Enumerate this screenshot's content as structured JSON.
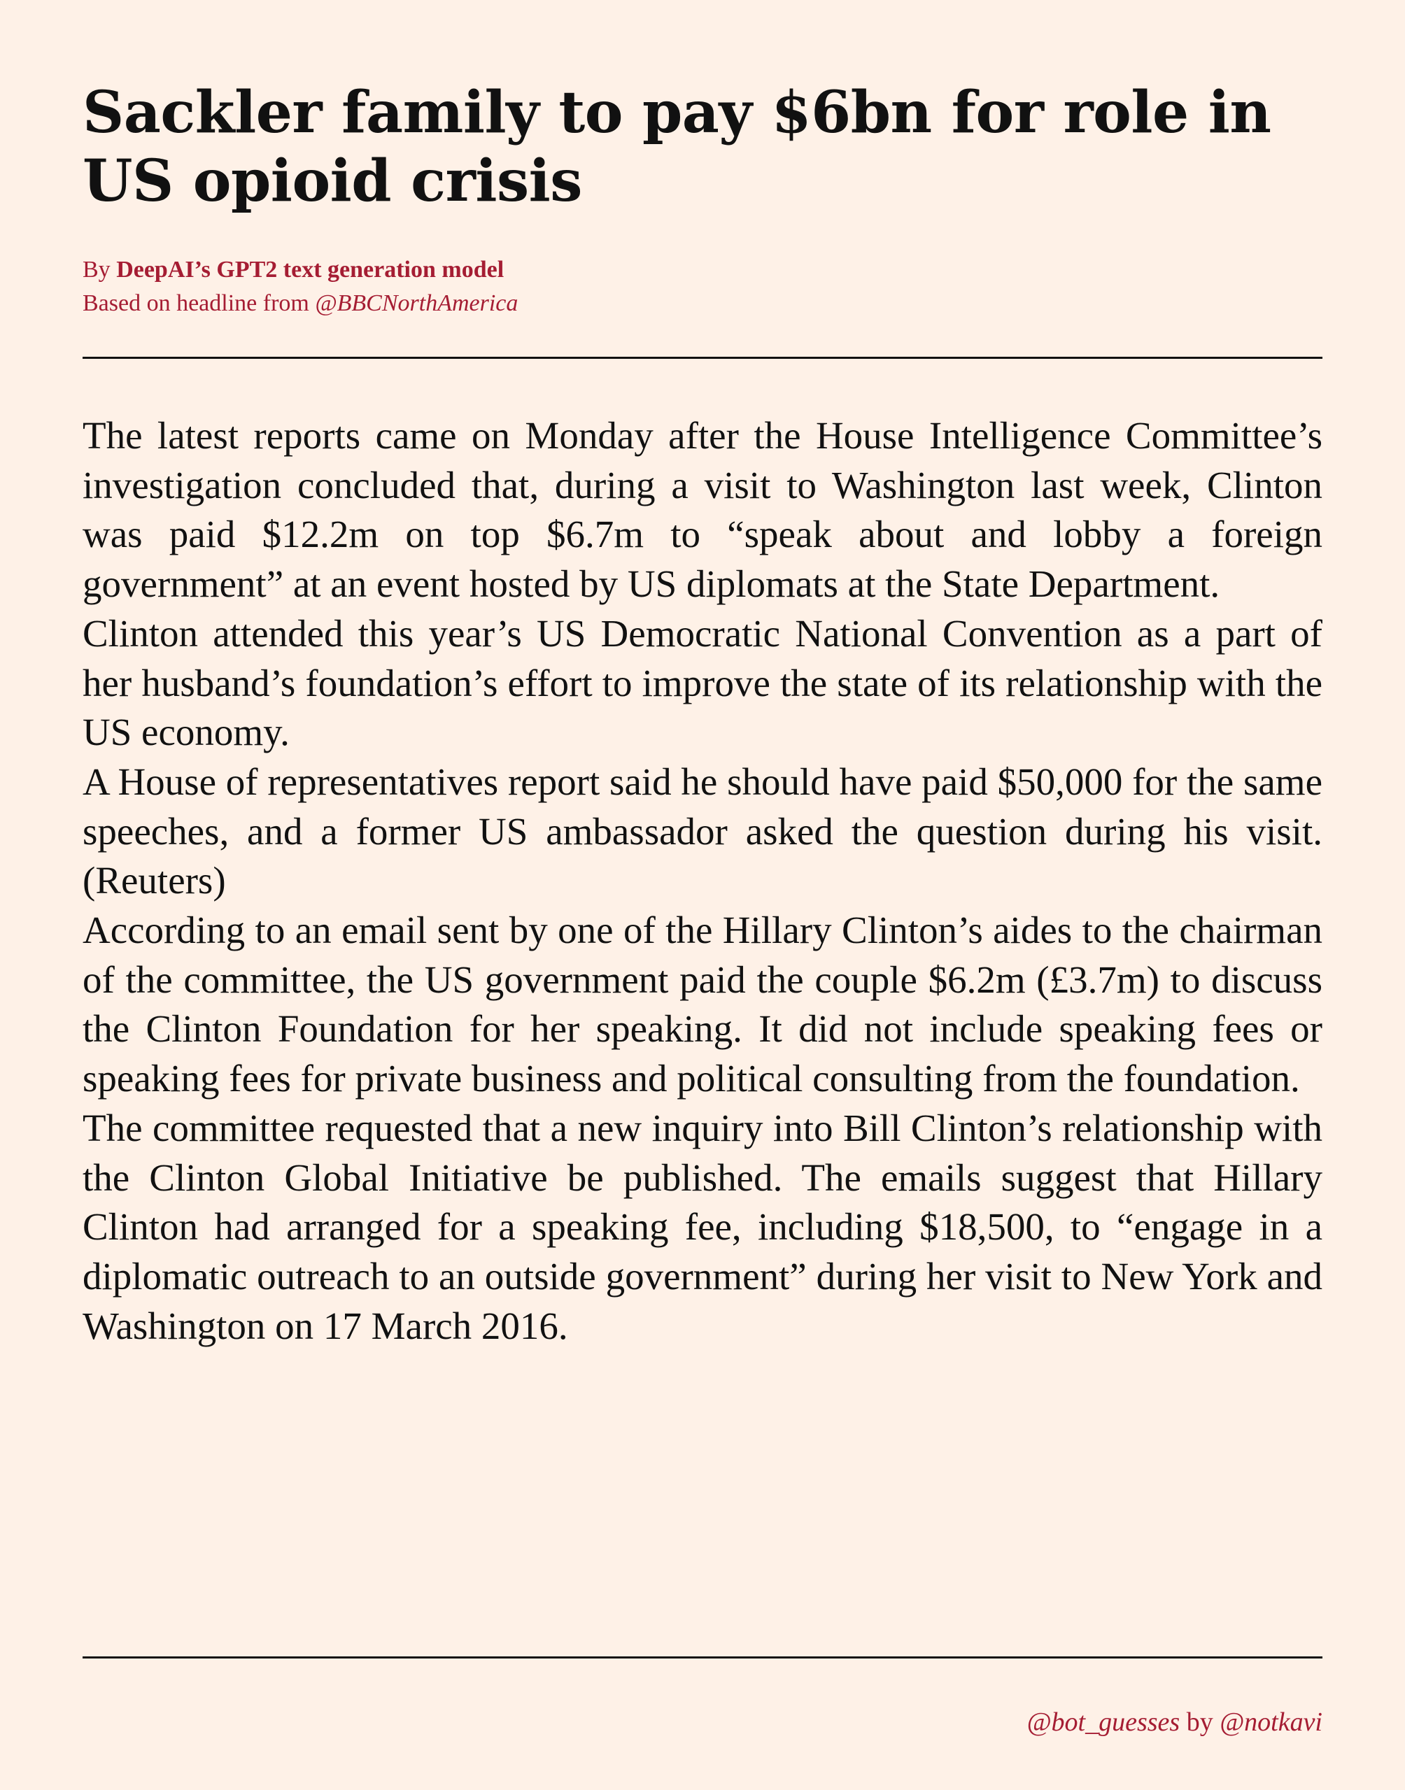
{
  "article": {
    "title": "Sackler family to pay $6bn for role in US opioid crisis",
    "byline_prefix": "By ",
    "byline_author": "DeepAI’s GPT2 text generation model",
    "source_prefix": "Based on headline from ",
    "source_handle": "@BBCNorthAmerica",
    "paragraphs": [
      "The latest reports came on Monday after the House Intelligence Committee’s investigation concluded that, during a visit to Washington last week, Clinton was paid $12.2m on top $6.7m to “speak about and lobby a foreign government” at an event hosted by US diplomats at the State Department.",
      "Clinton attended this year’s US Democratic National Convention as a part of her husband’s foundation’s effort to improve the state of its relationship with the US economy.",
      "A House of representatives report said he should have paid $50,000 for the same speeches, and a former US ambassador asked the question during his visit. (Reuters)",
      "According to an email sent by one of the Hillary Clinton’s aides to the chairman of the committee, the US government paid the couple $6.2m (£3.7m) to discuss the Clinton Foundation for her speaking. It did not include speaking fees or speaking fees for private business and political consulting from the foundation.",
      "The committee requested that a new inquiry into Bill Clinton’s relationship with the Clinton Global Initiative be published. The emails suggest that Hillary Clinton had arranged for a speaking fee, including $18,500, to “engage in a diplomatic outreach to an outside government” during her visit to New York and Washington on 17 March 2016."
    ]
  },
  "footer": {
    "bot_handle": "@bot_guesses",
    "by": " by ",
    "author_handle": "@notkavi"
  },
  "colors": {
    "accent": "#a51d33",
    "background": "#fef1e7",
    "text": "#111111"
  }
}
